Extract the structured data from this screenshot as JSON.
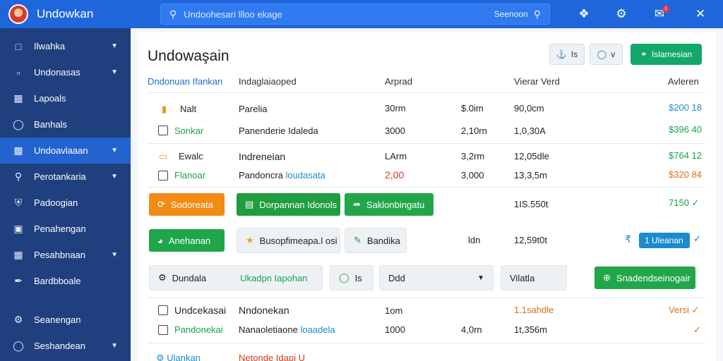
{
  "app": {
    "title": "Undowkan"
  },
  "search": {
    "placeholder": "Undoohesari llloo ekage",
    "button_label": "Seenoon"
  },
  "topbar": {
    "icon1": "settings-alt-icon",
    "icon2": "gear-icon",
    "icon3": "notification-icon",
    "icon4": "close-icon",
    "badge": "1"
  },
  "sidebar": {
    "items": [
      {
        "label": "Ilwahka",
        "icon": "file-icon",
        "has_chevron": true
      },
      {
        "label": "Undonasas",
        "icon": "folder-icon",
        "has_chevron": true
      },
      {
        "label": "Lapoals",
        "icon": "grid-icon",
        "has_chevron": false
      },
      {
        "label": "Banhals",
        "icon": "circle-icon",
        "has_chevron": false
      },
      {
        "label": "Undoavlaaan",
        "icon": "doc-icon",
        "has_chevron": true,
        "active": true
      },
      {
        "label": "Perotankaria",
        "icon": "search-icon",
        "has_chevron": true
      },
      {
        "label": "Padoogian",
        "icon": "shield-icon",
        "has_chevron": false
      },
      {
        "label": "Penahengan",
        "icon": "monitor-icon",
        "has_chevron": false
      },
      {
        "label": "Pesahbnaan",
        "icon": "table-icon",
        "has_chevron": true
      },
      {
        "label": "Bardbboale",
        "icon": "pen-icon",
        "has_chevron": false
      }
    ],
    "bottom": [
      {
        "label": "Seanengan",
        "icon": "settings-icon",
        "has_chevron": false
      },
      {
        "label": "Seshandean",
        "icon": "circle-icon",
        "has_chevron": true
      }
    ]
  },
  "main": {
    "title": "Undowaşain",
    "header_buttons": {
      "btn1": "Is",
      "btn2": "v",
      "btn3": "Islamesian"
    },
    "columns": [
      "Dndonuan Ifankan",
      "Indaglaiaoped",
      "Arprad",
      "Vierar Verd",
      "Avleren"
    ],
    "group1": {
      "row1": {
        "name": "Nalt",
        "desc": "Parelia",
        "c1": "30rm",
        "c2": "$.0im",
        "c3": "90,0cm",
        "amount": "$200 18"
      },
      "row2": {
        "name": "Sonkar",
        "desc": "Panenderie Idaleda",
        "c1": "3000",
        "c2": "2,10rn",
        "c3": "1,0,30A",
        "amount": "$396 40"
      }
    },
    "group2": {
      "row1": {
        "name": "Ewalc",
        "desc": "Indreneian",
        "c1": "LArm",
        "c2": "3,2rm",
        "c3": "12,05dle",
        "amount": "$764 12"
      },
      "row2": {
        "name": "Flanoar",
        "desc": "Pandoncra",
        "desc_link": "loudasata",
        "c1": "2,00",
        "c2": "3,000",
        "c3": "13,3,5m",
        "amount": "$320 84"
      }
    },
    "actions1": {
      "btn1": "Sodoreata",
      "btn2": "Dorpannan Idonols",
      "btn3": "Saklonbingatu",
      "value": "1IS.550t",
      "amount": "7150"
    },
    "actions2": {
      "btn1": "Anehanan",
      "btn2": "Busopfimeapa.l osi",
      "btn3": "Bandika",
      "c1": "ldn",
      "value": "12,59t0t",
      "chip": "1 Uleanan"
    },
    "filter": {
      "box1": "Dundala",
      "box1_link": "Ukadpn Iapohan",
      "box2": "Is",
      "select": "Ddd",
      "box3": "Vilatla",
      "button": "Snadendseinogair"
    },
    "group3": {
      "row1": {
        "name": "Undcekasai",
        "desc": "Nndonekan",
        "c1": "1om",
        "c3": "1.1sahdle",
        "amount": "Versi"
      },
      "row2": {
        "name": "Pandonekai",
        "desc": "Nanaoletiaone",
        "desc_link": "loaadela",
        "c1": "1000",
        "c2": "4,0rn",
        "c3": "1t,356m"
      }
    },
    "footer": {
      "left": "Ulankan",
      "right": "Netonde Idapi U"
    }
  }
}
